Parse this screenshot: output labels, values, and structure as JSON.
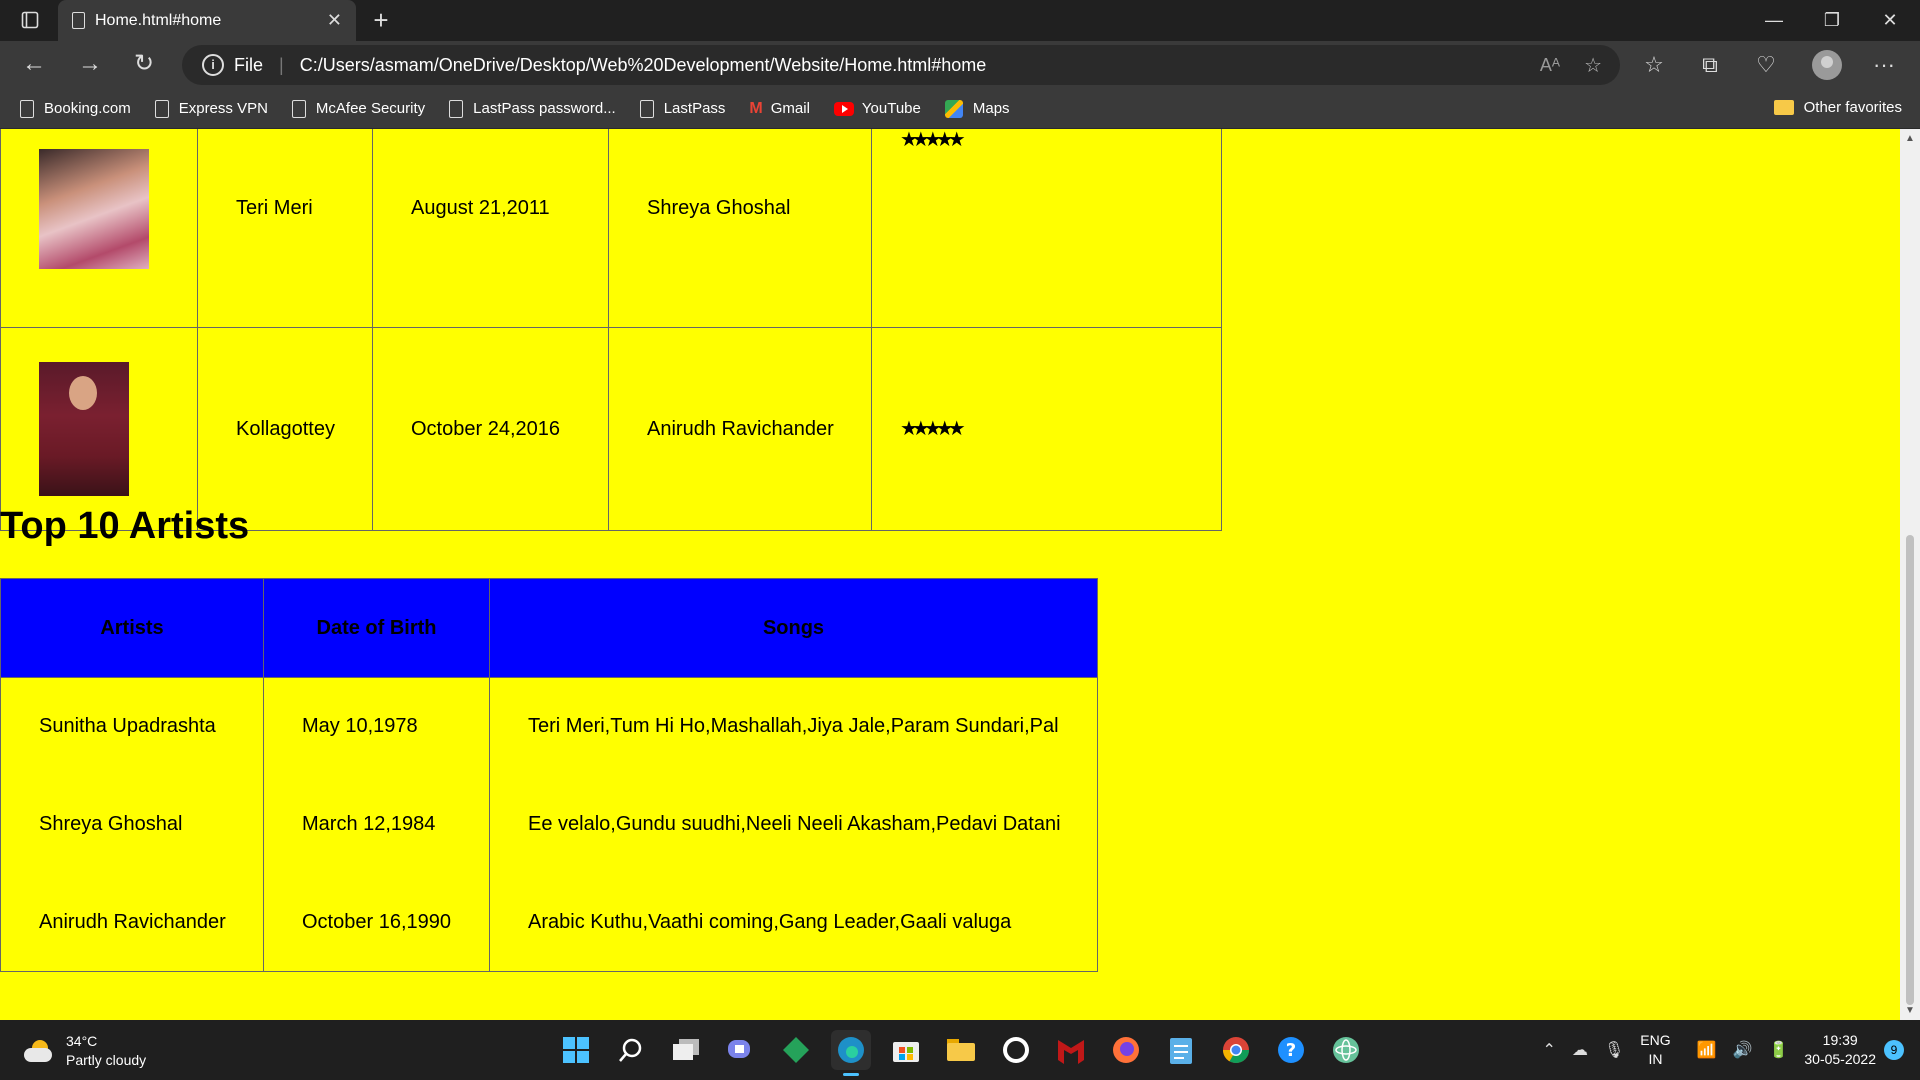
{
  "browser": {
    "tab_title": "Home.html#home",
    "tab_close": "✕",
    "new_tab": "+",
    "scheme": "File",
    "url": "C:/Users/asmam/OneDrive/Desktop/Web%20Development/Website/Home.html#home",
    "read_aloud": "Aᴬ",
    "bookmarks": [
      "Booking.com",
      "Express VPN",
      "McAfee Security",
      "LastPass password...",
      "LastPass",
      "Gmail",
      "YouTube",
      "Maps"
    ],
    "other_favorites": "Other favorites"
  },
  "songs_table": {
    "rows": [
      {
        "song": "Teri Meri",
        "release": "August 21,2011",
        "artist": "Shreya Ghoshal",
        "rating": "★★★★★"
      },
      {
        "song": "Kollagottey",
        "release": "October 24,2016",
        "artist": "Anirudh Ravichander",
        "rating": "★★★★★"
      }
    ]
  },
  "artists_section": {
    "title": "Top 10 Artists",
    "headers": [
      "Artists",
      "Date of Birth",
      "Songs"
    ],
    "rows": [
      {
        "name": "Sunitha Upadrashta",
        "dob": "May 10,1978",
        "songs": "Teri Meri,Tum Hi Ho,Mashallah,Jiya Jale,Param Sundari,Pal"
      },
      {
        "name": "Shreya Ghoshal",
        "dob": "March 12,1984",
        "songs": "Ee velalo,Gundu suudhi,Neeli Neeli Akasham,Pedavi Datani"
      },
      {
        "name": "Anirudh Ravichander",
        "dob": "October 16,1990",
        "songs": "Arabic Kuthu,Vaathi coming,Gang Leader,Gaali valuga"
      }
    ]
  },
  "taskbar": {
    "temperature": "34°C",
    "weather": "Partly cloudy",
    "lang_top": "ENG",
    "lang_bottom": "IN",
    "time": "19:39",
    "date": "30-05-2022",
    "notifications": "9"
  }
}
